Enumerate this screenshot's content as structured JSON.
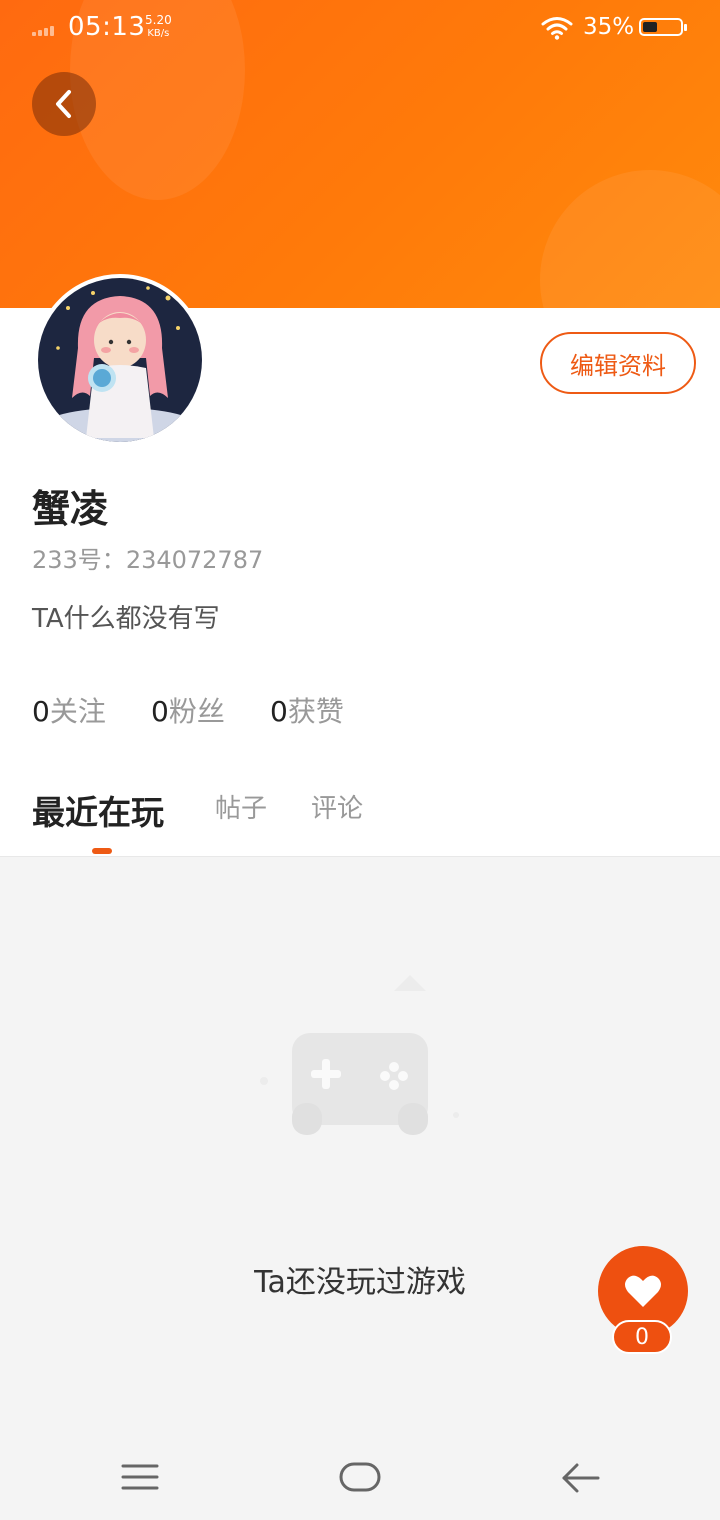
{
  "status_bar": {
    "time": "05:13",
    "speed_value": "5.20",
    "speed_unit": "KB/s",
    "battery": "35%"
  },
  "colors": {
    "accent": "#ee5a14",
    "header_start": "#ff6a10",
    "header_end": "#ff8a0c"
  },
  "profile": {
    "name": "蟹凌",
    "id_label": "233号：",
    "id_value": "234072787",
    "bio": "TA什么都没有写",
    "edit_label": "编辑资料"
  },
  "stats": [
    {
      "value": "0",
      "label": "关注"
    },
    {
      "value": "0",
      "label": "粉丝"
    },
    {
      "value": "0",
      "label": "获赞"
    }
  ],
  "tabs": [
    {
      "label": "最近在玩",
      "active": true
    },
    {
      "label": "帖子",
      "active": false
    },
    {
      "label": "评论",
      "active": false
    }
  ],
  "empty_state": {
    "text": "Ta还没玩过游戏",
    "icon": "gamepad-icon"
  },
  "like": {
    "icon": "heart-icon",
    "count": "0"
  },
  "nav": {
    "icons": [
      "menu-icon",
      "home-icon",
      "back-arrow-icon"
    ]
  }
}
